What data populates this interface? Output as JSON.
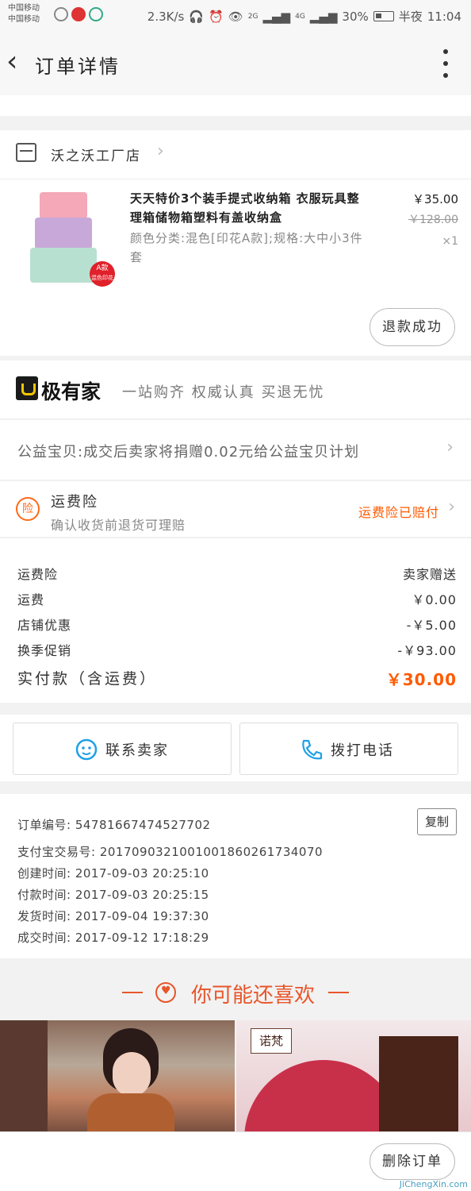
{
  "status_bar": {
    "carrier1": "中国移动",
    "carrier2": "中国移动",
    "net_speed": "2.3K/s",
    "signal1": "2G",
    "signal2": "4G",
    "battery": "30%",
    "am_pm": "半夜",
    "time": "11:04"
  },
  "nav": {
    "title": "订单详情"
  },
  "shop": {
    "name": "沃之沃工厂店"
  },
  "product": {
    "title": "天天特价3个装手提式收纳箱 衣服玩具整理箱储物箱塑料有盖收纳盒",
    "sku": "颜色分类:混色[印花A款];规格:大中小3件套",
    "price": "￥35.00",
    "original_price": "￥128.00",
    "quantity": "×1",
    "tag_line1": "A款",
    "tag_line2": "混色印花",
    "status_button": "退款成功"
  },
  "jiyoujia": {
    "name": "极有家",
    "slogan": "一站购齐 权威认真 买退无忧"
  },
  "charity": {
    "text": "公益宝贝:成交后卖家将捐赠0.02元给公益宝贝计划"
  },
  "insurance": {
    "icon_text": "险",
    "title": "运费险",
    "subtitle": "确认收货前退货可理赔",
    "status": "运费险已赔付"
  },
  "fees": [
    {
      "label": "运费险",
      "value": "卖家赠送"
    },
    {
      "label": "运费",
      "value": "￥0.00"
    },
    {
      "label": "店铺优惠",
      "value": "-￥5.00"
    },
    {
      "label": "换季促销",
      "value": "-￥93.00"
    }
  ],
  "total": {
    "label": "实付款（含运费）",
    "value": "￥30.00"
  },
  "contact": {
    "seller_label": "联系卖家",
    "phone_label": "拨打电话"
  },
  "order_info": {
    "order_no": "订单编号: 54781667474527702",
    "alipay_no": "支付宝交易号: 2017090321001001860261734070",
    "created": "创建时间: 2017-09-03 20:25:10",
    "paid": "付款时间: 2017-09-03 20:25:15",
    "shipped": "发货时间: 2017-09-04 19:37:30",
    "completed": "成交时间: 2017-09-12 17:18:29",
    "copy_label": "复制"
  },
  "recommend": {
    "title": "你可能还喜欢",
    "brand": "诺梵"
  },
  "bottom": {
    "delete_label": "删除订单",
    "watermark": "JiChengXin.com"
  },
  "colors": {
    "accent": "#ff5a00",
    "recommend": "#e8552a",
    "contact_icon": "#1ea0e6"
  }
}
